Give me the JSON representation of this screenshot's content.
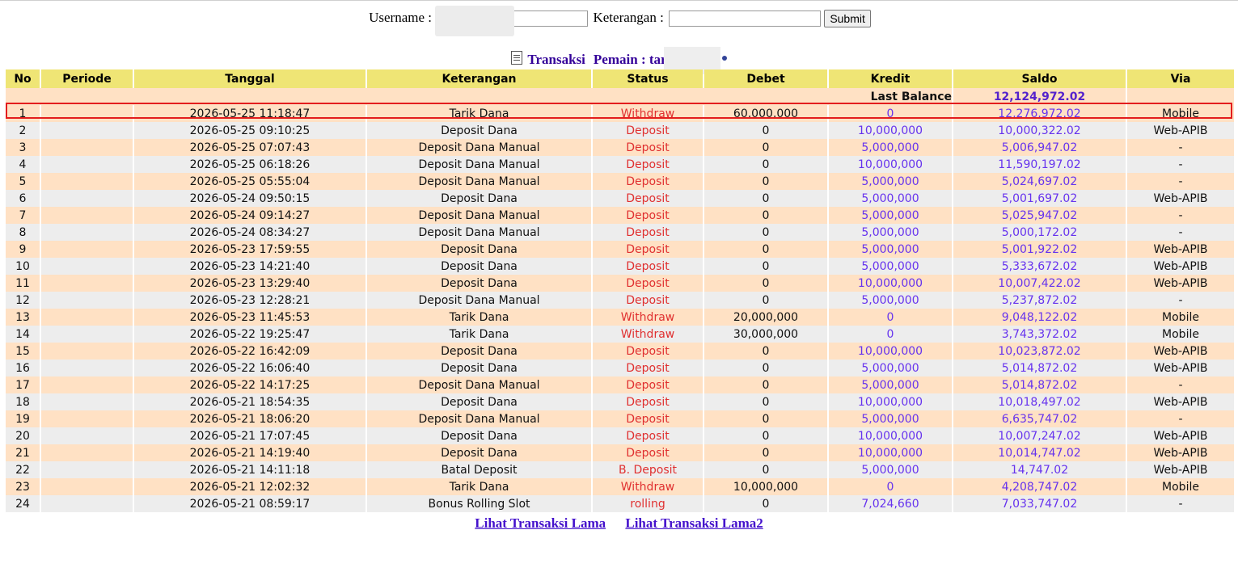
{
  "form": {
    "username_label": "Username :",
    "username_value": "",
    "keterangan_label": "Keterangan :",
    "keterangan_value": "",
    "submit_label": "Submit"
  },
  "heading": {
    "transaksi": "Transaksi",
    "pemain": "Pemain : tar",
    "icon": "document-icon"
  },
  "table": {
    "headers": [
      "No",
      "Periode",
      "Tanggal",
      "Keterangan",
      "Status",
      "Debet",
      "Kredit",
      "Saldo",
      "Via"
    ],
    "last_balance_label": "Last Balance",
    "last_balance_value": "12,124,972.02",
    "rows": [
      {
        "no": "1",
        "periode": "",
        "tanggal": "2026-05-25 11:18:47",
        "keterangan": "Tarik Dana",
        "status": "Withdraw",
        "debet": "60,000,000",
        "kredit": "0",
        "saldo": "12,276,972.02",
        "via": "Mobile"
      },
      {
        "no": "2",
        "periode": "",
        "tanggal": "2026-05-25 09:10:25",
        "keterangan": "Deposit Dana",
        "status": "Deposit",
        "debet": "0",
        "kredit": "10,000,000",
        "saldo": "10,000,322.02",
        "via": "Web-APIB"
      },
      {
        "no": "3",
        "periode": "",
        "tanggal": "2026-05-25 07:07:43",
        "keterangan": "Deposit Dana Manual",
        "status": "Deposit",
        "debet": "0",
        "kredit": "5,000,000",
        "saldo": "5,006,947.02",
        "via": "-"
      },
      {
        "no": "4",
        "periode": "",
        "tanggal": "2026-05-25 06:18:26",
        "keterangan": "Deposit Dana Manual",
        "status": "Deposit",
        "debet": "0",
        "kredit": "10,000,000",
        "saldo": "11,590,197.02",
        "via": "-"
      },
      {
        "no": "5",
        "periode": "",
        "tanggal": "2026-05-25 05:55:04",
        "keterangan": "Deposit Dana Manual",
        "status": "Deposit",
        "debet": "0",
        "kredit": "5,000,000",
        "saldo": "5,024,697.02",
        "via": "-"
      },
      {
        "no": "6",
        "periode": "",
        "tanggal": "2026-05-24 09:50:15",
        "keterangan": "Deposit Dana",
        "status": "Deposit",
        "debet": "0",
        "kredit": "5,000,000",
        "saldo": "5,001,697.02",
        "via": "Web-APIB"
      },
      {
        "no": "7",
        "periode": "",
        "tanggal": "2026-05-24 09:14:27",
        "keterangan": "Deposit Dana Manual",
        "status": "Deposit",
        "debet": "0",
        "kredit": "5,000,000",
        "saldo": "5,025,947.02",
        "via": "-"
      },
      {
        "no": "8",
        "periode": "",
        "tanggal": "2026-05-24 08:34:27",
        "keterangan": "Deposit Dana Manual",
        "status": "Deposit",
        "debet": "0",
        "kredit": "5,000,000",
        "saldo": "5,000,172.02",
        "via": "-"
      },
      {
        "no": "9",
        "periode": "",
        "tanggal": "2026-05-23 17:59:55",
        "keterangan": "Deposit Dana",
        "status": "Deposit",
        "debet": "0",
        "kredit": "5,000,000",
        "saldo": "5,001,922.02",
        "via": "Web-APIB"
      },
      {
        "no": "10",
        "periode": "",
        "tanggal": "2026-05-23 14:21:40",
        "keterangan": "Deposit Dana",
        "status": "Deposit",
        "debet": "0",
        "kredit": "5,000,000",
        "saldo": "5,333,672.02",
        "via": "Web-APIB"
      },
      {
        "no": "11",
        "periode": "",
        "tanggal": "2026-05-23 13:29:40",
        "keterangan": "Deposit Dana",
        "status": "Deposit",
        "debet": "0",
        "kredit": "10,000,000",
        "saldo": "10,007,422.02",
        "via": "Web-APIB"
      },
      {
        "no": "12",
        "periode": "",
        "tanggal": "2026-05-23 12:28:21",
        "keterangan": "Deposit Dana Manual",
        "status": "Deposit",
        "debet": "0",
        "kredit": "5,000,000",
        "saldo": "5,237,872.02",
        "via": "-"
      },
      {
        "no": "13",
        "periode": "",
        "tanggal": "2026-05-23 11:45:53",
        "keterangan": "Tarik Dana",
        "status": "Withdraw",
        "debet": "20,000,000",
        "kredit": "0",
        "saldo": "9,048,122.02",
        "via": "Mobile"
      },
      {
        "no": "14",
        "periode": "",
        "tanggal": "2026-05-22 19:25:47",
        "keterangan": "Tarik Dana",
        "status": "Withdraw",
        "debet": "30,000,000",
        "kredit": "0",
        "saldo": "3,743,372.02",
        "via": "Mobile"
      },
      {
        "no": "15",
        "periode": "",
        "tanggal": "2026-05-22 16:42:09",
        "keterangan": "Deposit Dana",
        "status": "Deposit",
        "debet": "0",
        "kredit": "10,000,000",
        "saldo": "10,023,872.02",
        "via": "Web-APIB"
      },
      {
        "no": "16",
        "periode": "",
        "tanggal": "2026-05-22 16:06:40",
        "keterangan": "Deposit Dana",
        "status": "Deposit",
        "debet": "0",
        "kredit": "5,000,000",
        "saldo": "5,014,872.02",
        "via": "Web-APIB"
      },
      {
        "no": "17",
        "periode": "",
        "tanggal": "2026-05-22 14:17:25",
        "keterangan": "Deposit Dana Manual",
        "status": "Deposit",
        "debet": "0",
        "kredit": "5,000,000",
        "saldo": "5,014,872.02",
        "via": "-"
      },
      {
        "no": "18",
        "periode": "",
        "tanggal": "2026-05-21 18:54:35",
        "keterangan": "Deposit Dana",
        "status": "Deposit",
        "debet": "0",
        "kredit": "10,000,000",
        "saldo": "10,018,497.02",
        "via": "Web-APIB"
      },
      {
        "no": "19",
        "periode": "",
        "tanggal": "2026-05-21 18:06:20",
        "keterangan": "Deposit Dana Manual",
        "status": "Deposit",
        "debet": "0",
        "kredit": "5,000,000",
        "saldo": "6,635,747.02",
        "via": "-"
      },
      {
        "no": "20",
        "periode": "",
        "tanggal": "2026-05-21 17:07:45",
        "keterangan": "Deposit Dana",
        "status": "Deposit",
        "debet": "0",
        "kredit": "10,000,000",
        "saldo": "10,007,247.02",
        "via": "Web-APIB"
      },
      {
        "no": "21",
        "periode": "",
        "tanggal": "2026-05-21 14:19:40",
        "keterangan": "Deposit Dana",
        "status": "Deposit",
        "debet": "0",
        "kredit": "10,000,000",
        "saldo": "10,014,747.02",
        "via": "Web-APIB"
      },
      {
        "no": "22",
        "periode": "",
        "tanggal": "2026-05-21 14:11:18",
        "keterangan": "Batal Deposit",
        "status": "B. Deposit",
        "debet": "0",
        "kredit": "5,000,000",
        "saldo": "14,747.02",
        "via": "Web-APIB"
      },
      {
        "no": "23",
        "periode": "",
        "tanggal": "2026-05-21 12:02:32",
        "keterangan": "Tarik Dana",
        "status": "Withdraw",
        "debet": "10,000,000",
        "kredit": "0",
        "saldo": "4,208,747.02",
        "via": "Mobile"
      },
      {
        "no": "24",
        "periode": "",
        "tanggal": "2026-05-21 08:59:17",
        "keterangan": "Bonus Rolling Slot",
        "status": "rolling",
        "debet": "0",
        "kredit": "7,024,660",
        "saldo": "7,033,747.02",
        "via": "-"
      }
    ]
  },
  "links": {
    "lama": "Lihat Transaksi Lama",
    "lama2": "Lihat Transaksi Lama2"
  },
  "colors": {
    "header_bg": "#efe575",
    "row_odd": "#ffe1c4",
    "row_even": "#ededed",
    "status_red": "#e03030",
    "amount_purple": "#6633ee",
    "link_purple": "#4411cc",
    "highlight_red": "#e31d1d"
  }
}
